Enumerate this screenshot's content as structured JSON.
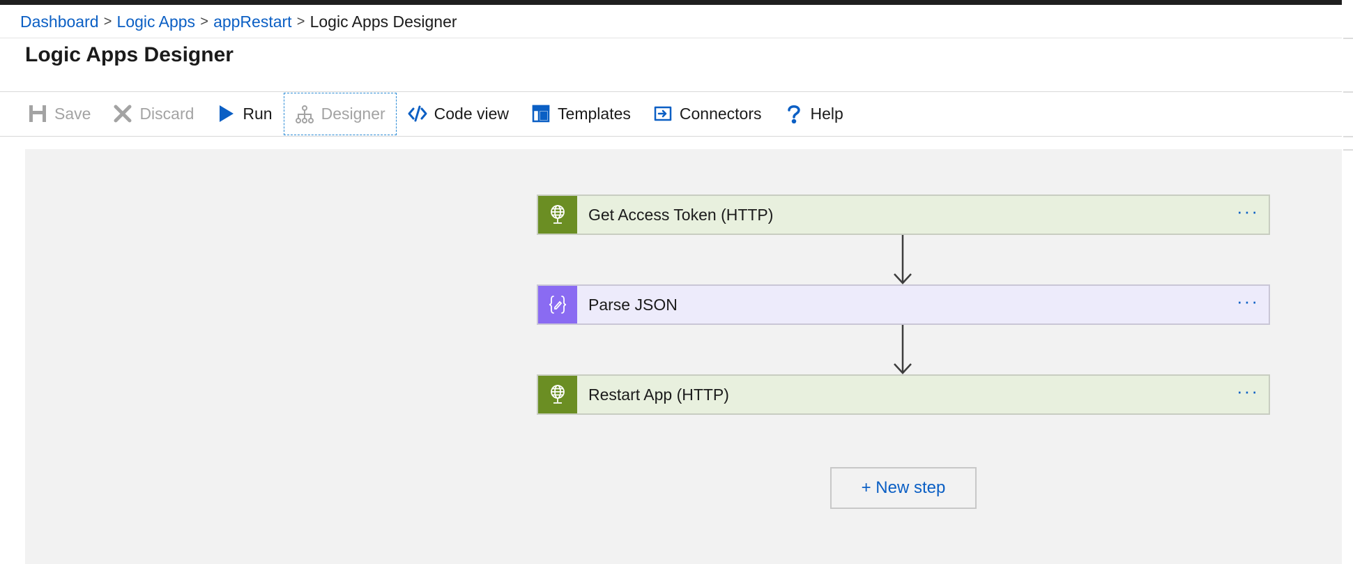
{
  "breadcrumb": {
    "items": [
      "Dashboard",
      "Logic Apps",
      "appRestart"
    ],
    "separator": ">",
    "current": "Logic Apps Designer"
  },
  "page": {
    "title": "Logic Apps Designer"
  },
  "toolbar": {
    "save": "Save",
    "discard": "Discard",
    "run": "Run",
    "designer": "Designer",
    "code_view": "Code view",
    "templates": "Templates",
    "connectors": "Connectors",
    "help": "Help"
  },
  "workflow": {
    "steps": [
      {
        "label": "Get Access Token (HTTP)",
        "type": "http",
        "icon": "globe-icon"
      },
      {
        "label": "Parse JSON",
        "type": "json",
        "icon": "json-braces-icon"
      },
      {
        "label": "Restart App (HTTP)",
        "type": "http",
        "icon": "globe-icon"
      }
    ],
    "more_label": "···",
    "new_step_label": "+ New step"
  },
  "colors": {
    "link": "#0b5fc4",
    "http_accent": "#6b8e23",
    "http_card_bg": "#e8f0de",
    "json_accent": "#8a6bf2",
    "json_card_bg": "#edebfb",
    "canvas_bg": "#f2f2f2"
  }
}
